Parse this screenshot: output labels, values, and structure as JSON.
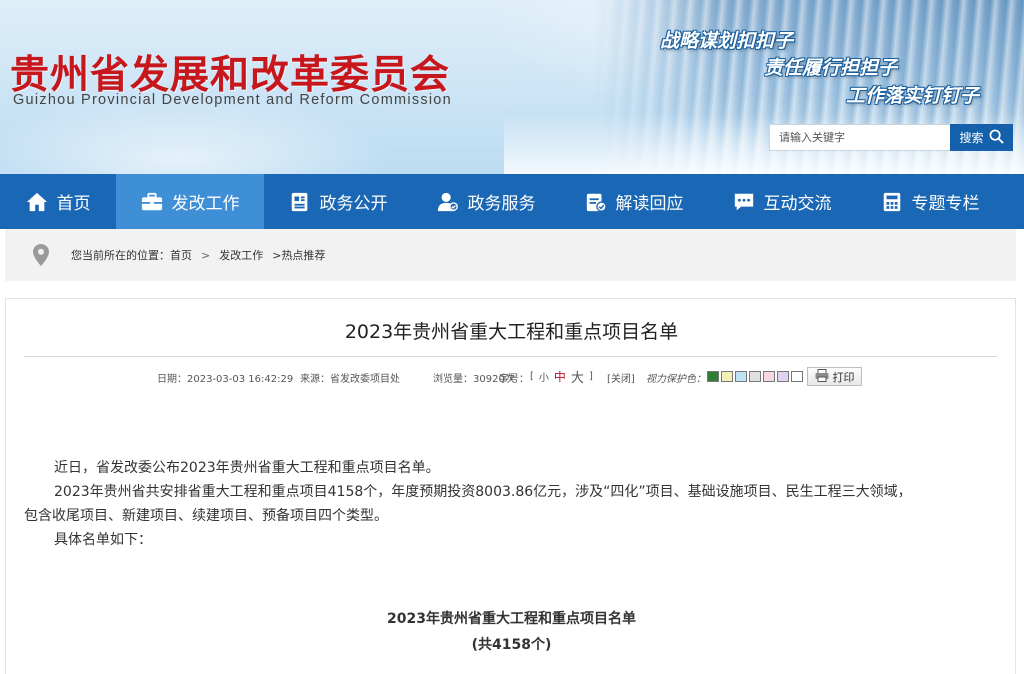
{
  "header": {
    "org_name_cn": "贵州省发展和改革委员会",
    "org_name_en": "Guizhou Provincial Development and Reform Commission",
    "slogans": [
      "战略谋划扣扣子",
      "责任履行担担子",
      "工作落实钉钉子"
    ],
    "search": {
      "placeholder": "请输入关键字",
      "button_label": "搜索"
    }
  },
  "nav": {
    "items": [
      {
        "label": "首页",
        "icon": "home-icon"
      },
      {
        "label": "发改工作",
        "icon": "briefcase-icon",
        "active": true
      },
      {
        "label": "政务公开",
        "icon": "document-icon"
      },
      {
        "label": "政务服务",
        "icon": "user-service-icon"
      },
      {
        "label": "解读回应",
        "icon": "clipboard-check-icon"
      },
      {
        "label": "互动交流",
        "icon": "chat-icon"
      },
      {
        "label": "专题专栏",
        "icon": "calculator-icon"
      }
    ]
  },
  "breadcrumb": {
    "prefix": "您当前所在的位置：",
    "items": [
      "首页",
      "发改工作",
      "热点推荐"
    ],
    "separator": ">",
    "last_prefix": ">"
  },
  "article": {
    "title": "2023年贵州省重大工程和重点项目名单",
    "meta": {
      "date": "日期：2023-03-03 16:42:29",
      "source": "来源：省发改委项目处",
      "views": "浏览量：30920次",
      "font_size_label": "字号：",
      "font_size_bracket_open": "[",
      "font_size_small": "小",
      "font_size_medium": "中",
      "font_size_large": "大",
      "font_size_bracket_close": "]",
      "close_label": "[关闭]",
      "vision_label": "视力保护色：",
      "vision_colors": [
        "#2e7d32",
        "#f3f0b5",
        "#bfe3f5",
        "#e0e0e0",
        "#f6d7e4",
        "#e1d3f0",
        "#ffffff"
      ],
      "print_label": "打印"
    },
    "paragraphs": [
      "近日，省发改委公布2023年贵州省重大工程和重点项目名单。",
      "2023年贵州省共安排省重大工程和重点项目4158个，年度预期投资8003.86亿元，涉及“四化”项目、基础设施项目、民生工程三大领域，",
      "包含收尾项目、新建项目、续建项目、预备项目四个类型。",
      "具体名单如下："
    ],
    "list_title": "2023年贵州省重大工程和重点项目名单",
    "list_count": "(共4158个)"
  },
  "colors": {
    "nav_bg": "#1a67b5",
    "nav_active": "#3f8fd6",
    "brand_red": "#c8161d",
    "search_button": "#1560ab"
  }
}
